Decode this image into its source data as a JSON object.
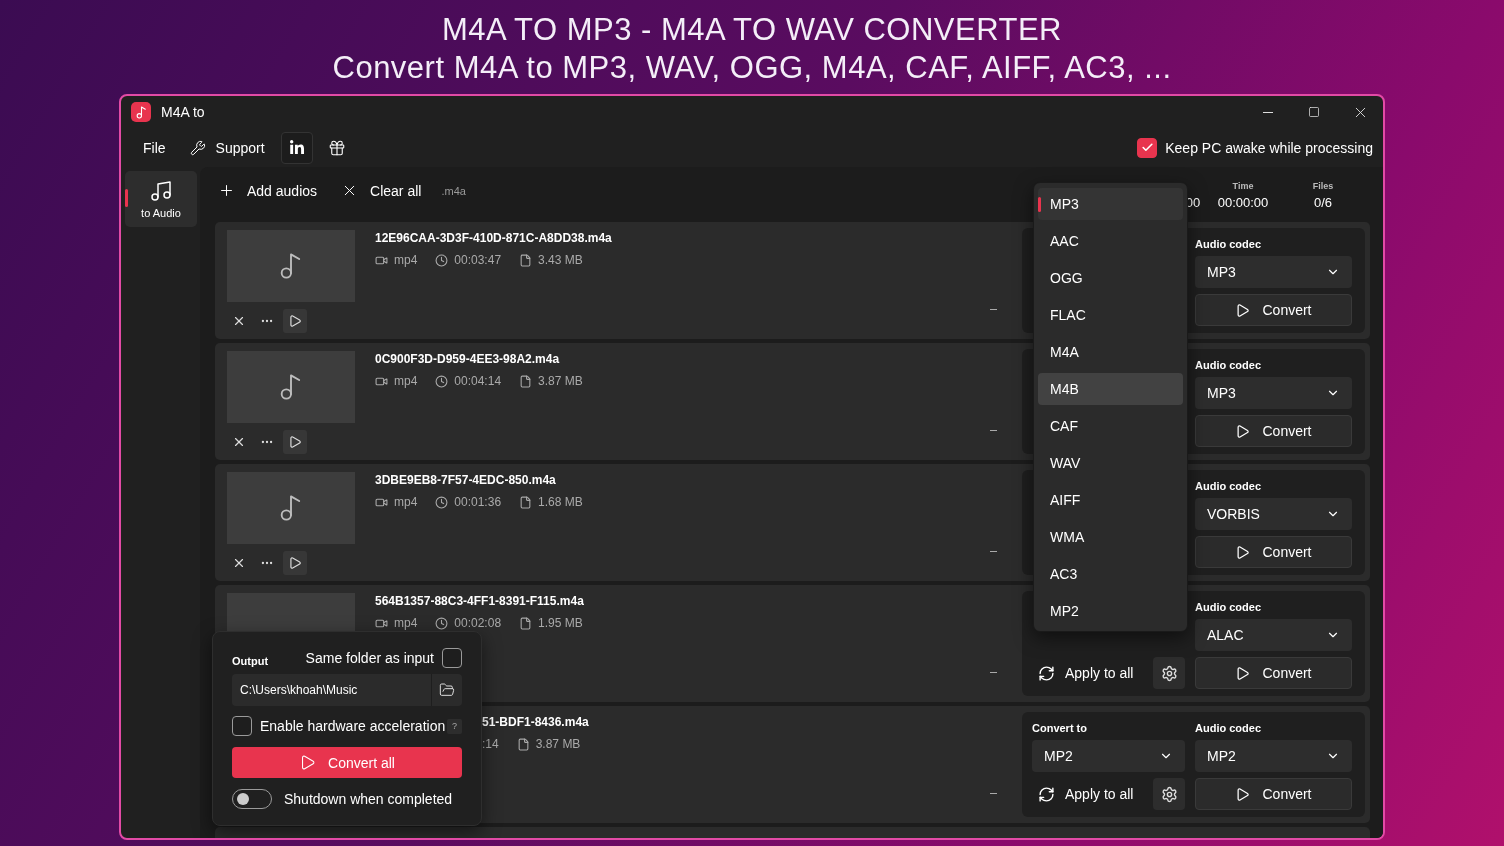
{
  "page_heading": {
    "line1": "M4A TO MP3 - M4A TO WAV CONVERTER",
    "line2": "Convert M4A to MP3, WAV, OGG, M4A, CAF, AIFF, AC3, ..."
  },
  "window": {
    "title": "M4A to"
  },
  "menu": {
    "file": "File",
    "support": "Support"
  },
  "keep_awake": {
    "label": "Keep PC awake while processing",
    "checked": true
  },
  "nav": [
    {
      "label": "to Audio",
      "selected": true
    }
  ],
  "toolbar": {
    "add": "Add audios",
    "clear": "Clear all",
    "extension": ".m4a"
  },
  "stats": [
    {
      "value": "00"
    },
    {
      "label": "Time",
      "value": "00:00:00"
    },
    {
      "label": "Files",
      "value": "0/6"
    }
  ],
  "rows": [
    {
      "kind": "full",
      "name": "12E96CAA-3D3F-410D-871C-A8DD38.m4a",
      "format": "mp4",
      "duration": "00:03:47",
      "size": "3.43 MB",
      "codec_label": "Audio codec",
      "codec": "MP3",
      "convert": "Convert"
    },
    {
      "kind": "full",
      "name": "0C900F3D-D959-4EE3-98A2.m4a",
      "format": "mp4",
      "duration": "00:04:14",
      "size": "3.87 MB",
      "codec_label": "Audio codec",
      "codec": "MP3",
      "convert": "Convert"
    },
    {
      "kind": "full",
      "name": "3DBE9EB8-7F57-4EDC-850.m4a",
      "format": "mp4",
      "duration": "00:01:36",
      "size": "1.68 MB",
      "codec_label": "Audio codec",
      "codec": "VORBIS",
      "convert": "Convert"
    },
    {
      "kind": "partial",
      "name": "564B1357-88C3-4FF1-8391-F115.m4a",
      "format": "mp4",
      "duration": "00:02:08",
      "size": "1.95 MB",
      "codec_label": "Audio codec",
      "codec": "ALAC",
      "apply": "Apply to all",
      "convert": "Convert"
    },
    {
      "kind": "offset",
      "name": "51-BDF1-8436.m4a",
      "duration": ":14",
      "size": "3.87 MB",
      "convert_to_label": "Convert to",
      "convert_to": "MP2",
      "codec_label": "Audio codec",
      "codec": "MP2",
      "apply": "Apply to all",
      "convert": "Convert"
    },
    {
      "kind": "cut"
    }
  ],
  "format_menu": [
    {
      "label": "MP3",
      "selected": true,
      "hovered": false
    },
    {
      "label": "AAC",
      "selected": false,
      "hovered": false
    },
    {
      "label": "OGG",
      "selected": false,
      "hovered": false
    },
    {
      "label": "FLAC",
      "selected": false,
      "hovered": false
    },
    {
      "label": "M4A",
      "selected": false,
      "hovered": false
    },
    {
      "label": "M4B",
      "selected": false,
      "hovered": true
    },
    {
      "label": "CAF",
      "selected": false,
      "hovered": false
    },
    {
      "label": "WAV",
      "selected": false,
      "hovered": false
    },
    {
      "label": "AIFF",
      "selected": false,
      "hovered": false
    },
    {
      "label": "WMA",
      "selected": false,
      "hovered": false
    },
    {
      "label": "AC3",
      "selected": false,
      "hovered": false
    },
    {
      "label": "MP2",
      "selected": false,
      "hovered": false
    }
  ],
  "output_panel": {
    "title": "Output",
    "same_folder": {
      "label": "Same folder as input",
      "checked": false
    },
    "path": "C:\\Users\\khoah\\Music",
    "hw_accel": {
      "label": "Enable hardware acceleration",
      "checked": false
    },
    "help": "?",
    "convert_all": "Convert all",
    "shutdown": {
      "label": "Shutdown when completed",
      "on": false
    }
  }
}
